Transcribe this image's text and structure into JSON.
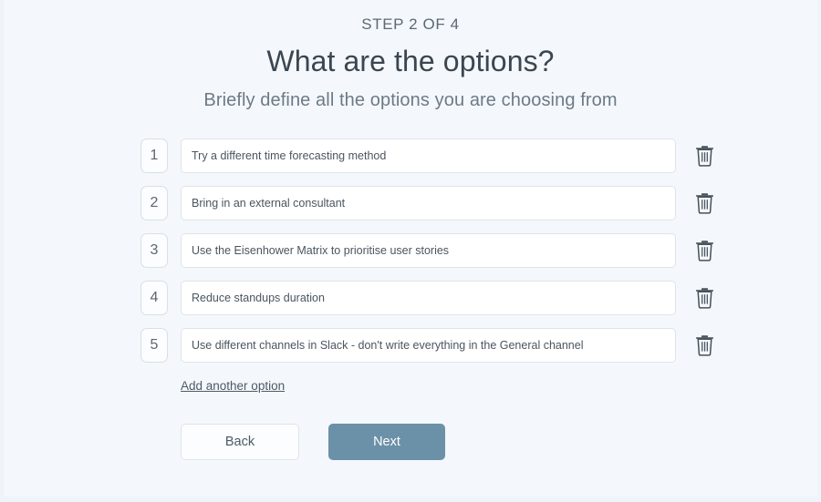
{
  "theme": {
    "page_background": "#f4f8fc",
    "window_edge": "#eef4fa",
    "accent": "#6b91a8",
    "text_primary": "#3b4650",
    "text_secondary": "#6d7a86",
    "border": "#dfe4e8"
  },
  "header": {
    "step_label": "STEP 2 OF 4",
    "title": "What are the options?",
    "subtitle": "Briefly define all the options you are choosing from"
  },
  "options": [
    {
      "number": "1",
      "value": "Try a different time forecasting method",
      "placeholder": "",
      "delete_icon": "trash-icon"
    },
    {
      "number": "2",
      "value": "Bring in an external consultant",
      "placeholder": "",
      "delete_icon": "trash-icon"
    },
    {
      "number": "3",
      "value": "Use the Eisenhower Matrix to prioritise user stories",
      "placeholder": "",
      "delete_icon": "trash-icon"
    },
    {
      "number": "4",
      "value": "Reduce standups duration",
      "placeholder": "",
      "delete_icon": "trash-icon"
    },
    {
      "number": "5",
      "value": "Use different channels in Slack - don't write everything in the General channel",
      "placeholder": "",
      "delete_icon": "trash-icon",
      "focused": true
    }
  ],
  "add_option": {
    "label": "Add another option"
  },
  "footer": {
    "back_label": "Back",
    "next_label": "Next"
  }
}
